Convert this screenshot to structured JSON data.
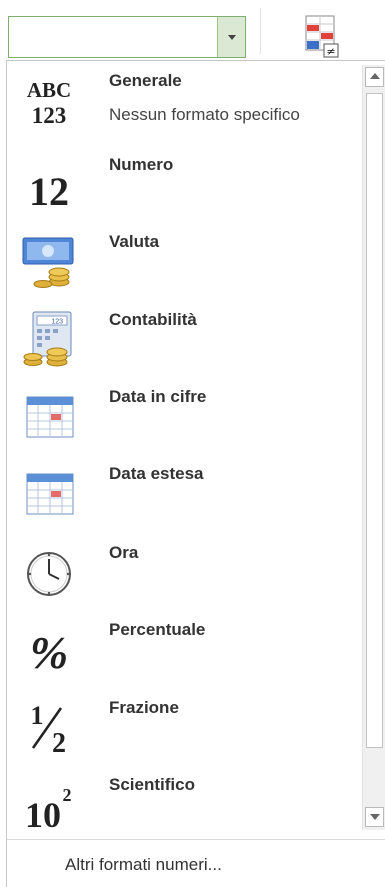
{
  "format_combo": {
    "value": ""
  },
  "items": [
    {
      "label": "Generale",
      "desc": "Nessun formato specifico",
      "icon": "abc-123-icon"
    },
    {
      "label": "Numero",
      "icon": "number-12-icon",
      "glyph": "12"
    },
    {
      "label": "Valuta",
      "icon": "currency-icon"
    },
    {
      "label": "Contabilità",
      "icon": "accounting-icon"
    },
    {
      "label": "Data in cifre",
      "icon": "calendar-icon"
    },
    {
      "label": "Data estesa",
      "icon": "calendar-icon"
    },
    {
      "label": "Ora",
      "icon": "clock-icon"
    },
    {
      "label": "Percentuale",
      "icon": "percent-icon",
      "glyph": "%"
    },
    {
      "label": "Frazione",
      "icon": "fraction-icon"
    },
    {
      "label": "Scientifico",
      "icon": "scientific-icon"
    }
  ],
  "icon_text": {
    "abc": "ABC",
    "num123": "123",
    "fraction_num": "1",
    "fraction_den": "2",
    "sci_base": "10",
    "sci_exp": "2",
    "calc_display": "123",
    "not_equal": "≠"
  },
  "footer": {
    "more_formats": "Altri formati numeri..."
  },
  "colors": {
    "combo_border": "#7fb06f",
    "combo_button": "#dbe9d4",
    "calendar_header": "#5b8fd6",
    "coin": "#e0b13a",
    "text": "#333333"
  }
}
